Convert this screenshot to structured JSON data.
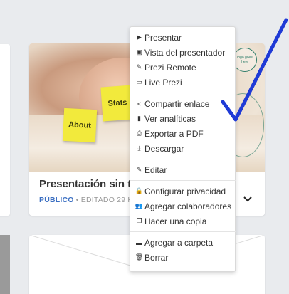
{
  "card": {
    "title": "Presentación sin título",
    "visibility": "PÚBLICO",
    "edited": "• EDITADO 29 HACE DÍAS",
    "notes": {
      "stats": "Stats",
      "about": "About"
    },
    "logo_text": "logo goes here"
  },
  "menu": {
    "groups": [
      [
        {
          "label": "Presentar",
          "icon": "play-icon",
          "glyph": "▶"
        },
        {
          "label": "Vista del presentador",
          "icon": "presenter-view-icon",
          "glyph": "▣"
        },
        {
          "label": "Prezi Remote",
          "icon": "remote-icon",
          "glyph": "✎"
        },
        {
          "label": "Live Prezi",
          "icon": "laptop-icon",
          "glyph": "▭"
        }
      ],
      [
        {
          "label": "Compartir enlace",
          "icon": "share-icon",
          "glyph": "<"
        },
        {
          "label": "Ver analíticas",
          "icon": "analytics-icon",
          "glyph": "▮"
        },
        {
          "label": "Exportar a PDF",
          "icon": "export-pdf-icon",
          "glyph": "⎙"
        },
        {
          "label": "Descargar",
          "icon": "download-icon",
          "glyph": "⤓"
        }
      ],
      [
        {
          "label": "Editar",
          "icon": "edit-icon",
          "glyph": "✎"
        }
      ],
      [
        {
          "label": "Configurar privacidad",
          "icon": "lock-icon",
          "glyph": "🔒"
        },
        {
          "label": "Agregar colaboradores",
          "icon": "collaborators-icon",
          "glyph": "👥"
        },
        {
          "label": "Hacer una copia",
          "icon": "copy-icon",
          "glyph": "❐"
        }
      ],
      [
        {
          "label": "Agregar a carpeta",
          "icon": "folder-icon",
          "glyph": "▬"
        },
        {
          "label": "Borrar",
          "icon": "trash-icon",
          "glyph": "🗑"
        }
      ]
    ]
  },
  "colors": {
    "background": "#e9ebee",
    "accent_blue": "#3b6fc2",
    "annotation_stroke": "#1f3ad6",
    "sticky_note": "#f2ea3c"
  }
}
